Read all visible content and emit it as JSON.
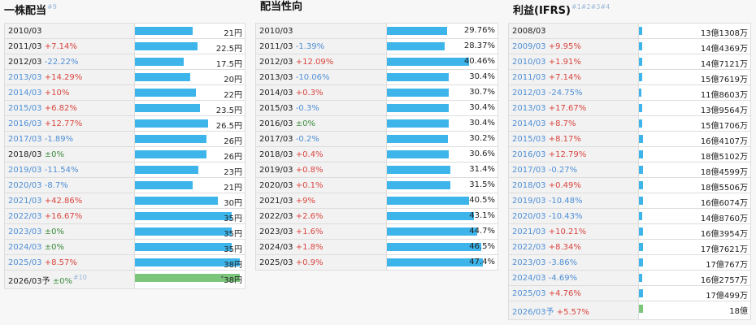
{
  "dividend": {
    "title": "一株配当",
    "title_note": "#9",
    "max": 40,
    "rows": [
      {
        "date": "2010/03",
        "chg": "",
        "cls": "",
        "value": 21,
        "label": "21円",
        "link": false
      },
      {
        "date": "2011/03",
        "chg": "+7.14%",
        "cls": "up",
        "value": 22.5,
        "label": "22.5円",
        "link": false
      },
      {
        "date": "2012/03",
        "chg": "-22.22%",
        "cls": "down",
        "value": 17.5,
        "label": "17.5円",
        "link": false
      },
      {
        "date": "2013/03",
        "chg": "+14.29%",
        "cls": "up",
        "value": 20,
        "label": "20円",
        "link": true
      },
      {
        "date": "2014/03",
        "chg": "+10%",
        "cls": "up",
        "value": 22,
        "label": "22円",
        "link": true
      },
      {
        "date": "2015/03",
        "chg": "+6.82%",
        "cls": "up",
        "value": 23.5,
        "label": "23.5円",
        "link": true
      },
      {
        "date": "2016/03",
        "chg": "+12.77%",
        "cls": "up",
        "value": 26.5,
        "label": "26.5円",
        "link": true
      },
      {
        "date": "2017/03",
        "chg": "-1.89%",
        "cls": "down",
        "value": 26,
        "label": "26円",
        "link": true
      },
      {
        "date": "2018/03",
        "chg": "±0%",
        "cls": "flat",
        "value": 26,
        "label": "26円",
        "link": false
      },
      {
        "date": "2019/03",
        "chg": "-11.54%",
        "cls": "down",
        "value": 23,
        "label": "23円",
        "link": true
      },
      {
        "date": "2020/03",
        "chg": "-8.7%",
        "cls": "down",
        "value": 21,
        "label": "21円",
        "link": true
      },
      {
        "date": "2021/03",
        "chg": "+42.86%",
        "cls": "up",
        "value": 30,
        "label": "30円",
        "link": true
      },
      {
        "date": "2022/03",
        "chg": "+16.67%",
        "cls": "up",
        "value": 35,
        "label": "35円",
        "link": true
      },
      {
        "date": "2023/03",
        "chg": "±0%",
        "cls": "flat",
        "value": 35,
        "label": "35円",
        "link": true
      },
      {
        "date": "2024/03",
        "chg": "±0%",
        "cls": "flat",
        "value": 35,
        "label": "35円",
        "link": true
      },
      {
        "date": "2025/03",
        "chg": "+8.57%",
        "cls": "up",
        "value": 38,
        "label": "38円",
        "link": true
      }
    ],
    "forecast": {
      "date": "2026/03予",
      "chg": "±0%",
      "cls": "flat",
      "note": "#10",
      "value": 38,
      "label": "38円",
      "star": "*"
    }
  },
  "payout": {
    "title": "配当性向",
    "max": 55,
    "rows": [
      {
        "date": "2010/03",
        "chg": "",
        "cls": "",
        "value": 29.76,
        "label": "29.76%"
      },
      {
        "date": "2011/03",
        "chg": "-1.39%",
        "cls": "down",
        "value": 28.37,
        "label": "28.37%"
      },
      {
        "date": "2012/03",
        "chg": "+12.09%",
        "cls": "up",
        "value": 40.46,
        "label": "40.46%"
      },
      {
        "date": "2013/03",
        "chg": "-10.06%",
        "cls": "down",
        "value": 30.4,
        "label": "30.4%"
      },
      {
        "date": "2014/03",
        "chg": "+0.3%",
        "cls": "up",
        "value": 30.7,
        "label": "30.7%"
      },
      {
        "date": "2015/03",
        "chg": "-0.3%",
        "cls": "down",
        "value": 30.4,
        "label": "30.4%"
      },
      {
        "date": "2016/03",
        "chg": "±0%",
        "cls": "flat",
        "value": 30.4,
        "label": "30.4%"
      },
      {
        "date": "2017/03",
        "chg": "-0.2%",
        "cls": "down",
        "value": 30.2,
        "label": "30.2%"
      },
      {
        "date": "2018/03",
        "chg": "+0.4%",
        "cls": "up",
        "value": 30.6,
        "label": "30.6%"
      },
      {
        "date": "2019/03",
        "chg": "+0.8%",
        "cls": "up",
        "value": 31.4,
        "label": "31.4%"
      },
      {
        "date": "2020/03",
        "chg": "+0.1%",
        "cls": "up",
        "value": 31.5,
        "label": "31.5%"
      },
      {
        "date": "2021/03",
        "chg": "+9%",
        "cls": "up",
        "value": 40.5,
        "label": "40.5%"
      },
      {
        "date": "2022/03",
        "chg": "+2.6%",
        "cls": "up",
        "value": 43.1,
        "label": "43.1%"
      },
      {
        "date": "2023/03",
        "chg": "+1.6%",
        "cls": "up",
        "value": 44.7,
        "label": "44.7%"
      },
      {
        "date": "2024/03",
        "chg": "+1.8%",
        "cls": "up",
        "value": 46.5,
        "label": "46.5%"
      },
      {
        "date": "2025/03",
        "chg": "+0.9%",
        "cls": "up",
        "value": 47.4,
        "label": "47.4%"
      }
    ]
  },
  "profit": {
    "title": "利益(IFRS)",
    "title_note": "#1#2#3#4",
    "max": 500,
    "rows": [
      {
        "date": "2008/03",
        "chg": "",
        "cls": "",
        "value": 13.1308,
        "label": "13億1308万",
        "link": false
      },
      {
        "date": "2009/03",
        "chg": "+9.95%",
        "cls": "up",
        "value": 14.4369,
        "label": "14億4369万",
        "link": true
      },
      {
        "date": "2010/03",
        "chg": "+1.91%",
        "cls": "up",
        "value": 14.7121,
        "label": "14億7121万",
        "link": true
      },
      {
        "date": "2011/03",
        "chg": "+7.14%",
        "cls": "up",
        "value": 15.7619,
        "label": "15億7619万",
        "link": true
      },
      {
        "date": "2012/03",
        "chg": "-24.75%",
        "cls": "down",
        "value": 11.8603,
        "label": "11億8603万",
        "link": true
      },
      {
        "date": "2013/03",
        "chg": "+17.67%",
        "cls": "up",
        "value": 13.9564,
        "label": "13億9564万",
        "link": true
      },
      {
        "date": "2014/03",
        "chg": "+8.7%",
        "cls": "up",
        "value": 15.1706,
        "label": "15億1706万",
        "link": true
      },
      {
        "date": "2015/03",
        "chg": "+8.17%",
        "cls": "up",
        "value": 16.4107,
        "label": "16億4107万",
        "link": true
      },
      {
        "date": "2016/03",
        "chg": "+12.79%",
        "cls": "up",
        "value": 18.5102,
        "label": "18億5102万",
        "link": true
      },
      {
        "date": "2017/03",
        "chg": "-0.27%",
        "cls": "down",
        "value": 18.4599,
        "label": "18億4599万",
        "link": true
      },
      {
        "date": "2018/03",
        "chg": "+0.49%",
        "cls": "up",
        "value": 18.5506,
        "label": "18億5506万",
        "link": true
      },
      {
        "date": "2019/03",
        "chg": "-10.48%",
        "cls": "down",
        "value": 16.6074,
        "label": "16億6074万",
        "link": true
      },
      {
        "date": "2020/03",
        "chg": "-10.43%",
        "cls": "down",
        "value": 14.876,
        "label": "14億8760万",
        "link": true
      },
      {
        "date": "2021/03",
        "chg": "+10.21%",
        "cls": "up",
        "value": 16.3954,
        "label": "16億3954万",
        "link": true
      },
      {
        "date": "2022/03",
        "chg": "+8.34%",
        "cls": "up",
        "value": 17.7621,
        "label": "17億7621万",
        "link": true
      },
      {
        "date": "2023/03",
        "chg": "-3.86%",
        "cls": "down",
        "value": 17.0767,
        "label": "17億767万",
        "link": true
      },
      {
        "date": "2024/03",
        "chg": "-4.69%",
        "cls": "down",
        "value": 16.2757,
        "label": "16億2757万",
        "link": true
      },
      {
        "date": "2025/03",
        "chg": "+4.76%",
        "cls": "up",
        "value": 17.0499,
        "label": "17億499万",
        "link": true
      }
    ],
    "forecast": {
      "date": "2026/03予",
      "chg": "+5.57%",
      "cls": "up",
      "value": 18,
      "label": "18億",
      "link": true
    }
  },
  "colors": {
    "bar": "#3db4ea",
    "forecast_bar": "#7bc67b",
    "up": "#d9453f",
    "down": "#4f8fd6",
    "flat": "#3a8a3a"
  }
}
